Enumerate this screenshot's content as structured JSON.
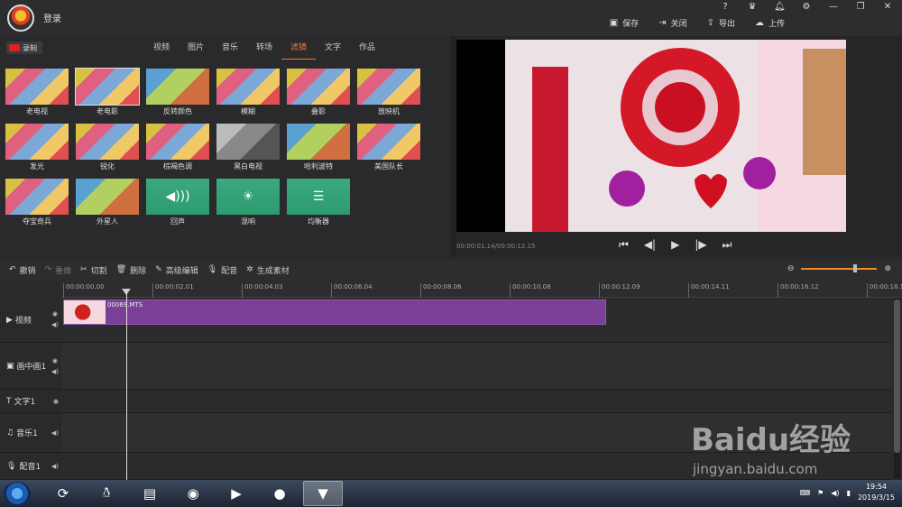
{
  "header": {
    "login_label": "登录",
    "buttons": {
      "save": "保存",
      "close": "关闭",
      "export": "导出",
      "upload": "上传"
    }
  },
  "panel": {
    "record_label": "录制",
    "tabs": [
      "视频",
      "图片",
      "音乐",
      "转场",
      "滤镜",
      "文字",
      "作品"
    ],
    "active_tab_index": 4,
    "filters": [
      [
        "老电视",
        "老电影",
        "反转颜色",
        "模糊",
        "叠影",
        "放映机"
      ],
      [
        "发光",
        "锐化",
        "棕褐色调",
        "黑白电视",
        "哈利波特",
        "美国队长"
      ],
      [
        "夺宝奇兵",
        "外星人",
        "回声",
        "混响",
        "均衡器"
      ]
    ]
  },
  "preview": {
    "timecode": "00:00:01.14/00:00:12.15"
  },
  "edit_toolbar": {
    "undo": "撤销",
    "redo": "重做",
    "cut": "切割",
    "delete": "删除",
    "advanced_edit": "高级编辑",
    "dub": "配音",
    "generate": "生成素材"
  },
  "timeline": {
    "ruler": [
      "00:00:00.00",
      "00:00:02.01",
      "00:00:04.03",
      "00:00:06.04",
      "00:00:08.06",
      "00:00:10.08",
      "00:00:12.09",
      "00:00:14.11",
      "00:00:16.12",
      "00:00:18.1"
    ],
    "tracks": {
      "video": "视频",
      "pip": "画中画1",
      "text": "文字1",
      "music": "音乐1",
      "voice": "配音1"
    },
    "clip_name": "00069.MTS"
  },
  "taskbar": {
    "time": "19:54",
    "date": "2019/3/15"
  },
  "watermark": {
    "logo": "Baidu经验",
    "url": "jingyan.baidu.com"
  },
  "colors": {
    "accent": "#f0783c",
    "clip": "#7b3f98",
    "effect_tile": "#3aaa7e"
  }
}
